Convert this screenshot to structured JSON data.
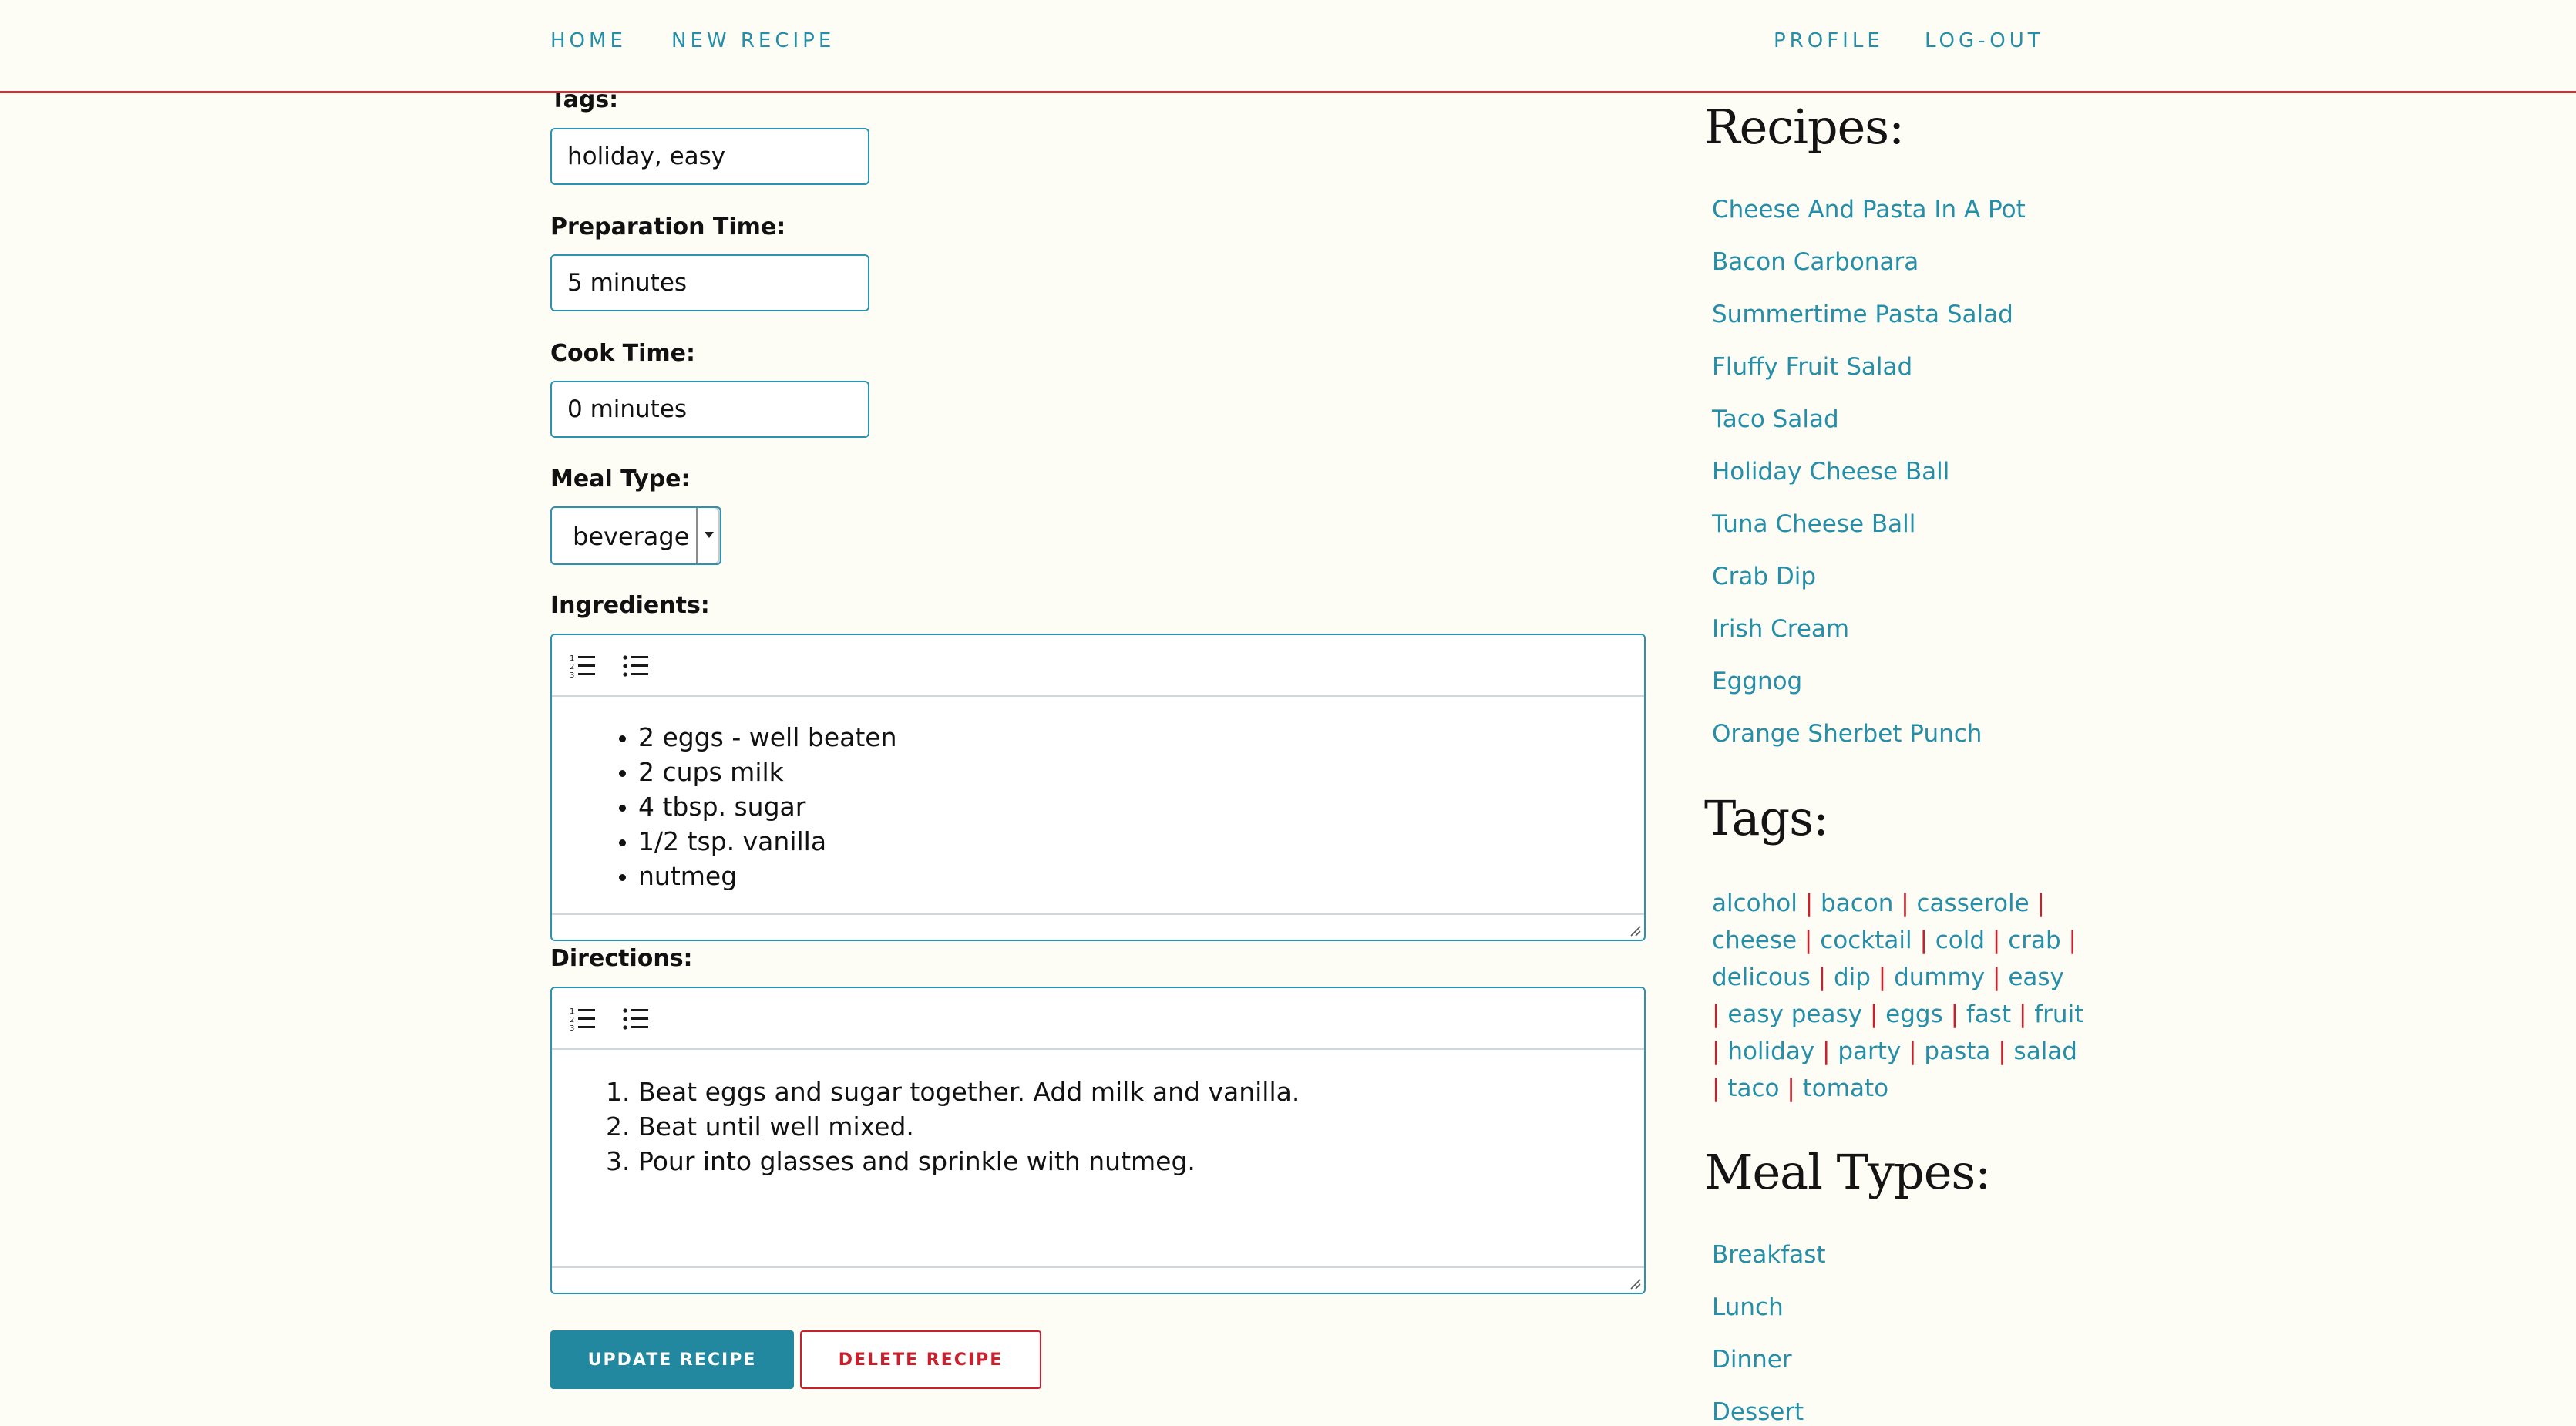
{
  "nav": {
    "home": "HOME",
    "new_recipe": "NEW RECIPE",
    "profile": "PROFILE",
    "logout": "LOG-OUT"
  },
  "form": {
    "tags_label": "Tags:",
    "tags_value": "holiday, easy",
    "prep_label": "Preparation Time:",
    "prep_value": "5 minutes",
    "cook_label": "Cook Time:",
    "cook_value": "0 minutes",
    "meal_type_label": "Meal Type:",
    "meal_type_value": "beverage",
    "ingredients_label": "Ingredients:",
    "ingredients": [
      "2 eggs - well beaten",
      "2 cups milk",
      "4 tbsp. sugar",
      "1/2 tsp. vanilla",
      "nutmeg"
    ],
    "directions_label": "Directions:",
    "directions": [
      "Beat eggs and sugar together. Add milk and vanilla.",
      "Beat until well mixed.",
      "Pour into glasses and sprinkle with nutmeg."
    ],
    "toolbar_icons": [
      "ordered-list-icon",
      "bullet-list-icon"
    ],
    "update_button": "UPDATE RECIPE",
    "delete_button": "DELETE RECIPE"
  },
  "sidebar": {
    "recipes_heading": "Recipes:",
    "recipes": [
      "Cheese And Pasta In A Pot",
      "Bacon Carbonara",
      "Summertime Pasta Salad",
      "Fluffy Fruit Salad",
      "Taco Salad",
      "Holiday Cheese Ball",
      "Tuna Cheese Ball",
      "Crab Dip",
      "Irish Cream",
      "Eggnog",
      "Orange Sherbet Punch"
    ],
    "tags_heading": "Tags:",
    "tag_lines": [
      [
        "alcohol",
        "bacon",
        "casserole",
        ""
      ],
      [
        "cheese",
        "cocktail",
        "cold",
        "crab",
        ""
      ],
      [
        "delicous",
        "dip",
        "dummy",
        "easy"
      ],
      [
        "",
        "easy peasy",
        "eggs",
        "fast",
        "fruit"
      ],
      [
        "",
        "holiday",
        "party",
        "pasta",
        "salad"
      ],
      [
        "",
        "taco",
        "tomato"
      ]
    ],
    "meal_types_heading": "Meal Types:",
    "meal_types": [
      "Breakfast",
      "Lunch",
      "Dinner",
      "Dessert"
    ]
  },
  "colors": {
    "accent": "#258ea8",
    "danger": "#c8202c",
    "background": "#fdfdf6"
  }
}
